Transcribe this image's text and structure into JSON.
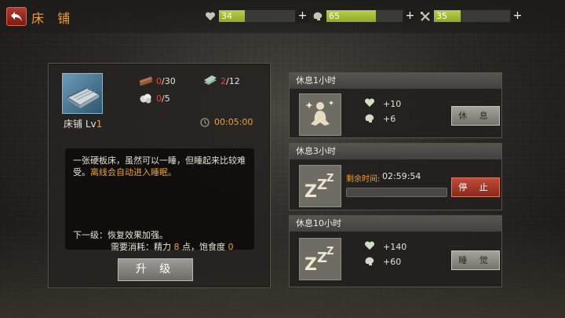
{
  "header": {
    "title": "床 铺",
    "stats": [
      {
        "icon": "heart-icon",
        "value": "34",
        "fraction": 0.34,
        "plus": "+"
      },
      {
        "icon": "brain-icon",
        "value": "65",
        "fraction": 0.65,
        "plus": "+"
      },
      {
        "icon": "crossed-tools-icon",
        "value": "35",
        "fraction": 0.35,
        "plus": "+"
      }
    ]
  },
  "bed": {
    "name": "床铺 Lv",
    "level": "1",
    "timer": "00:05:00",
    "resources": [
      {
        "icon": "wood-planks-icon",
        "current": "0",
        "total": "/30"
      },
      {
        "icon": "metal-sheets-icon",
        "current": "2",
        "total": "/12"
      },
      {
        "icon": "cloth-icon",
        "current": "0",
        "total": "/5"
      }
    ],
    "description_main": "一张硬板床，虽然可以一睡，但睡起来比较难受。",
    "description_highlight": "离线会自动进入睡眠。",
    "next_level": "下一级：恢复效果加强。",
    "cost_prefix": "需要消耗：精力 ",
    "cost_energy": "8",
    "cost_mid": " 点，饱食度 ",
    "cost_food": "0",
    "upgrade_label": "升 级"
  },
  "rest_options": [
    {
      "title": "休息1小时",
      "icon": "meditation-icon",
      "gain_health": "+10",
      "gain_mind": "+6",
      "button": "休 息"
    },
    {
      "title": "休息3小时",
      "icon": "sleep-zzz-icon",
      "remaining_label": "剩余时间:",
      "remaining_time": "02:59:54",
      "progress": 0.0,
      "button": "停 止"
    },
    {
      "title": "休息10小时",
      "icon": "sleep-zzz-icon",
      "gain_health": "+140",
      "gain_mind": "+60",
      "button": "睡 觉"
    }
  ]
}
